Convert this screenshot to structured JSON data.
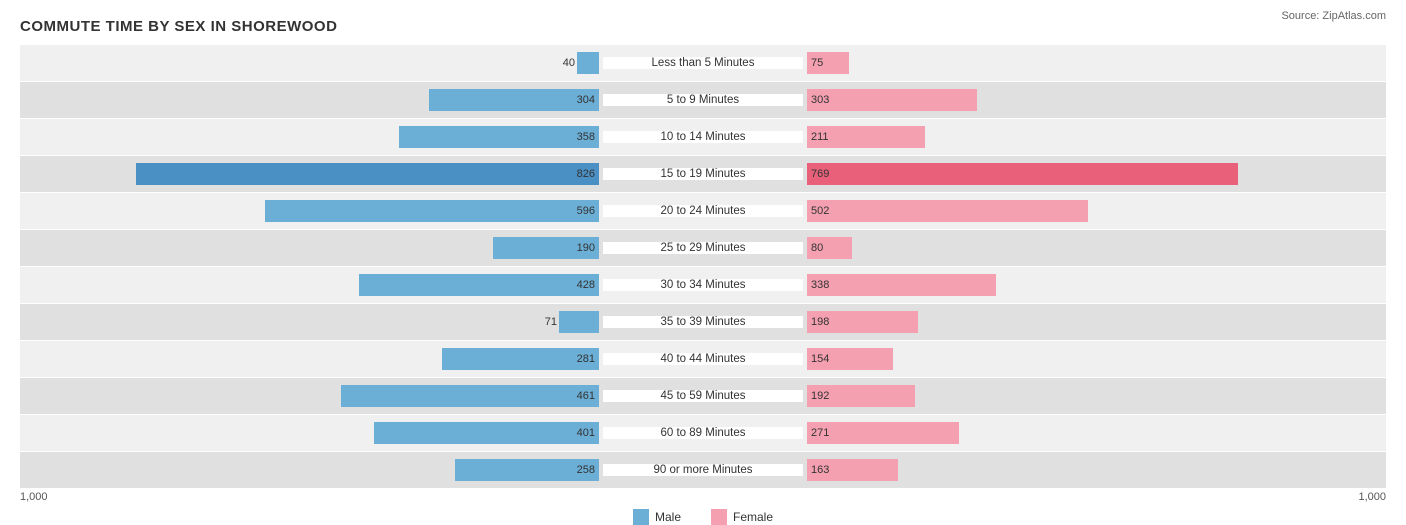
{
  "title": "COMMUTE TIME BY SEX IN SHOREWOOD",
  "source": "Source: ZipAtlas.com",
  "chart": {
    "max_value": 1000,
    "center_width": 200,
    "rows": [
      {
        "label": "Less than 5 Minutes",
        "male": 40,
        "female": 75
      },
      {
        "label": "5 to 9 Minutes",
        "male": 304,
        "female": 303
      },
      {
        "label": "10 to 14 Minutes",
        "male": 358,
        "female": 211
      },
      {
        "label": "15 to 19 Minutes",
        "male": 826,
        "female": 769
      },
      {
        "label": "20 to 24 Minutes",
        "male": 596,
        "female": 502
      },
      {
        "label": "25 to 29 Minutes",
        "male": 190,
        "female": 80
      },
      {
        "label": "30 to 34 Minutes",
        "male": 428,
        "female": 338
      },
      {
        "label": "35 to 39 Minutes",
        "male": 71,
        "female": 198
      },
      {
        "label": "40 to 44 Minutes",
        "male": 281,
        "female": 154
      },
      {
        "label": "45 to 59 Minutes",
        "male": 461,
        "female": 192
      },
      {
        "label": "60 to 89 Minutes",
        "male": 401,
        "female": 271
      },
      {
        "label": "90 or more Minutes",
        "male": 258,
        "female": 163
      }
    ],
    "legend": {
      "male_label": "Male",
      "female_label": "Female",
      "male_color": "#6baed6",
      "female_color": "#f4a0b0"
    },
    "axis_left": "1,000",
    "axis_right": "1,000"
  }
}
